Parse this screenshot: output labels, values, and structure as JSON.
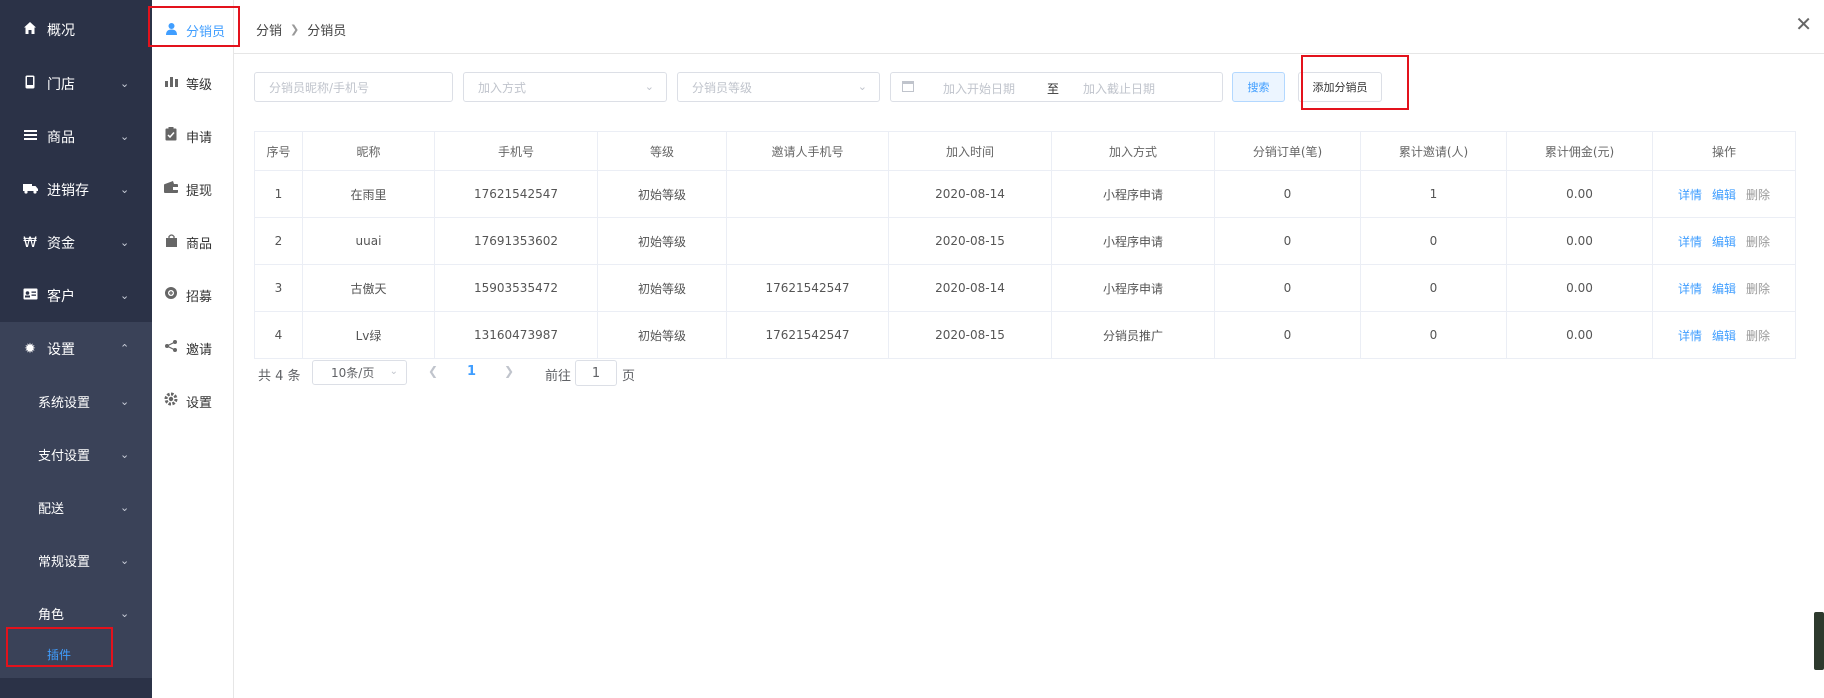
{
  "sidebar": {
    "items": [
      {
        "label": "概况",
        "icon": "home-icon"
      },
      {
        "label": "门店",
        "icon": "phone-icon"
      },
      {
        "label": "商品",
        "icon": "list-icon"
      },
      {
        "label": "进销存",
        "icon": "truck-icon"
      },
      {
        "label": "资金",
        "icon": "won-icon"
      },
      {
        "label": "客户",
        "icon": "id-card-icon"
      },
      {
        "label": "设置",
        "icon": "gear-icon"
      }
    ],
    "sub_items": [
      {
        "label": "系统设置"
      },
      {
        "label": "支付设置"
      },
      {
        "label": "配送"
      },
      {
        "label": "常规设置"
      },
      {
        "label": "角色"
      },
      {
        "label": "插件"
      }
    ]
  },
  "submenu": {
    "items": [
      {
        "label": "分销员",
        "icon": "user-icon"
      },
      {
        "label": "等级",
        "icon": "bar-chart-icon"
      },
      {
        "label": "申请",
        "icon": "clipboard-icon"
      },
      {
        "label": "提现",
        "icon": "wallet-icon"
      },
      {
        "label": "商品",
        "icon": "bag-icon"
      },
      {
        "label": "招募",
        "icon": "gear-badge-icon"
      },
      {
        "label": "邀请",
        "icon": "share-icon"
      },
      {
        "label": "设置",
        "icon": "settings-icon"
      }
    ]
  },
  "breadcrumb": {
    "root": "分销",
    "current": "分销员"
  },
  "filters": {
    "keyword_placeholder": "分销员昵称/手机号",
    "join_method_placeholder": "加入方式",
    "level_placeholder": "分销员等级",
    "start_date_placeholder": "加入开始日期",
    "range_separator": "至",
    "end_date_placeholder": "加入截止日期",
    "search_label": "搜索",
    "add_label": "添加分销员"
  },
  "table": {
    "headers": [
      "序号",
      "昵称",
      "手机号",
      "等级",
      "邀请人手机号",
      "加入时间",
      "加入方式",
      "分销订单(笔)",
      "累计邀请(人)",
      "累计佣金(元)",
      "操作"
    ],
    "rows": [
      [
        "1",
        "在雨里",
        "17621542547",
        "初始等级",
        "",
        "2020-08-14",
        "小程序申请",
        "0",
        "1",
        "0.00"
      ],
      [
        "2",
        "uuai",
        "17691353602",
        "初始等级",
        "",
        "2020-08-15",
        "小程序申请",
        "0",
        "0",
        "0.00"
      ],
      [
        "3",
        "古傲天",
        "15903535472",
        "初始等级",
        "17621542547",
        "2020-08-14",
        "小程序申请",
        "0",
        "0",
        "0.00"
      ],
      [
        "4",
        "Lv绿",
        "13160473987",
        "初始等级",
        "17621542547",
        "2020-08-15",
        "分销员推广",
        "0",
        "0",
        "0.00"
      ]
    ],
    "actions": {
      "detail": "详情",
      "edit": "编辑",
      "delete": "删除"
    }
  },
  "pagination": {
    "total": "共 4 条",
    "page_size": "10条/页",
    "current_page": "1",
    "goto_label": "前往",
    "goto_value": "1",
    "page_suffix": "页"
  },
  "colors": {
    "sidebar_bg": "#2b3247",
    "accent": "#409eff",
    "annotation": "#e3121c"
  }
}
